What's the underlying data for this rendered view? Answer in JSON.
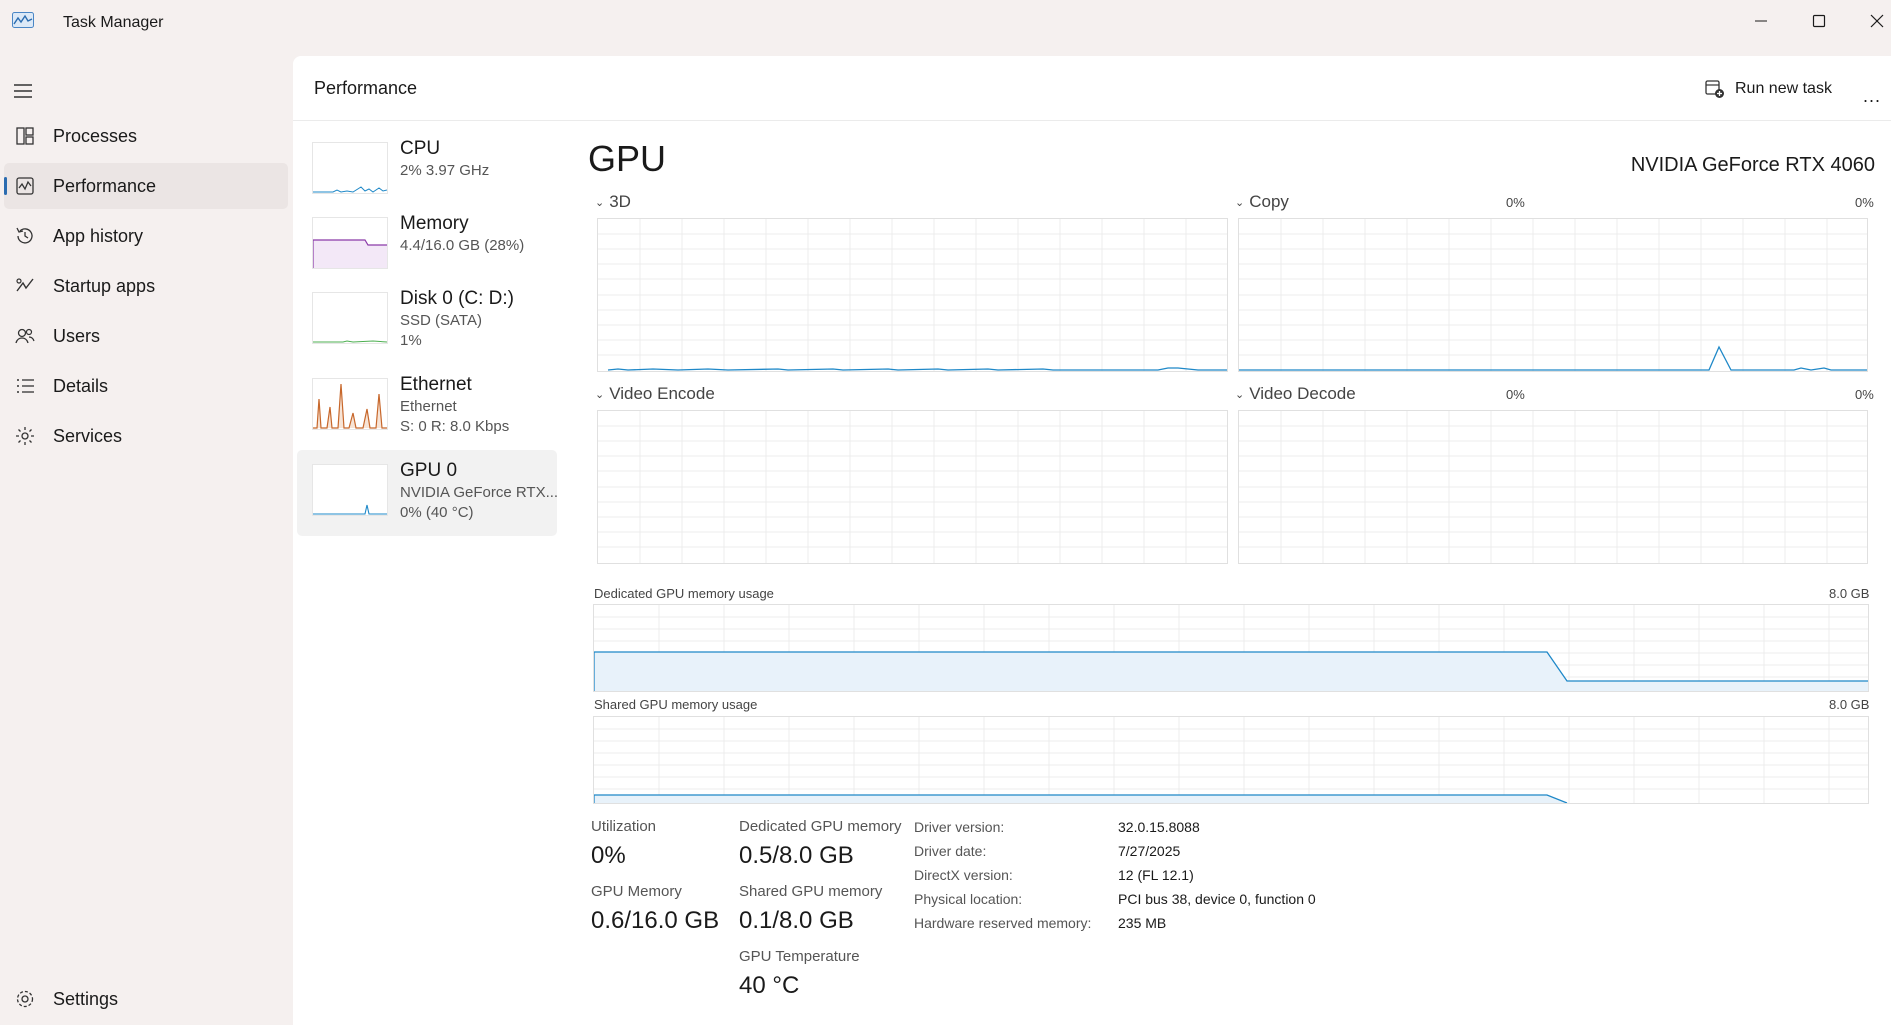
{
  "window": {
    "title": "Task Manager"
  },
  "sidebar": {
    "items": [
      {
        "label": "Processes",
        "icon": "processes-icon"
      },
      {
        "label": "Performance",
        "icon": "performance-icon",
        "active": true
      },
      {
        "label": "App history",
        "icon": "history-icon"
      },
      {
        "label": "Startup apps",
        "icon": "startup-icon"
      },
      {
        "label": "Users",
        "icon": "users-icon"
      },
      {
        "label": "Details",
        "icon": "details-icon"
      },
      {
        "label": "Services",
        "icon": "services-icon"
      }
    ],
    "settings_label": "Settings"
  },
  "header": {
    "title": "Performance",
    "run_task_label": "Run new task",
    "more_label": "..."
  },
  "resources": [
    {
      "name": "CPU",
      "line1": "2% 3.97 GHz",
      "line2": ""
    },
    {
      "name": "Memory",
      "line1": "4.4/16.0 GB (28%)",
      "line2": ""
    },
    {
      "name": "Disk 0 (C: D:)",
      "line1": "SSD (SATA)",
      "line2": "1%"
    },
    {
      "name": "Ethernet",
      "line1": "Ethernet",
      "line2": "S: 0 R: 8.0 Kbps"
    },
    {
      "name": "GPU 0",
      "line1": "NVIDIA GeForce RTX...",
      "line2": "0% (40 °C)",
      "active": true
    }
  ],
  "gpu": {
    "title": "GPU",
    "model": "NVIDIA GeForce RTX 4060",
    "engines": [
      {
        "name": "3D",
        "pct": "0%"
      },
      {
        "name": "Copy",
        "pct": "0%"
      },
      {
        "name": "Video Encode",
        "pct": "0%"
      },
      {
        "name": "Video Decode",
        "pct": "0%"
      }
    ],
    "dedicated_graph": {
      "label": "Dedicated GPU memory usage",
      "max": "8.0 GB"
    },
    "shared_graph": {
      "label": "Shared GPU memory usage",
      "max": "8.0 GB"
    },
    "stats": {
      "utilization_label": "Utilization",
      "utilization": "0%",
      "gpu_memory_label": "GPU Memory",
      "gpu_memory": "0.6/16.0 GB",
      "dedicated_label": "Dedicated GPU memory",
      "dedicated": "0.5/8.0 GB",
      "shared_label": "Shared GPU memory",
      "shared": "0.1/8.0 GB",
      "temp_label": "GPU Temperature",
      "temp": "40 °C"
    },
    "info": [
      {
        "key": "Driver version:",
        "value": "32.0.15.8088"
      },
      {
        "key": "Driver date:",
        "value": "7/27/2025"
      },
      {
        "key": "DirectX version:",
        "value": "12 (FL 12.1)"
      },
      {
        "key": "Physical location:",
        "value": "PCI bus 38, device 0, function 0"
      },
      {
        "key": "Hardware reserved memory:",
        "value": "235 MB"
      }
    ]
  },
  "colors": {
    "accent": "#2b6cb0",
    "gpu_line": "#1e88c8",
    "memory_line": "#8b3aa8",
    "ethernet_line": "#c7672b"
  }
}
